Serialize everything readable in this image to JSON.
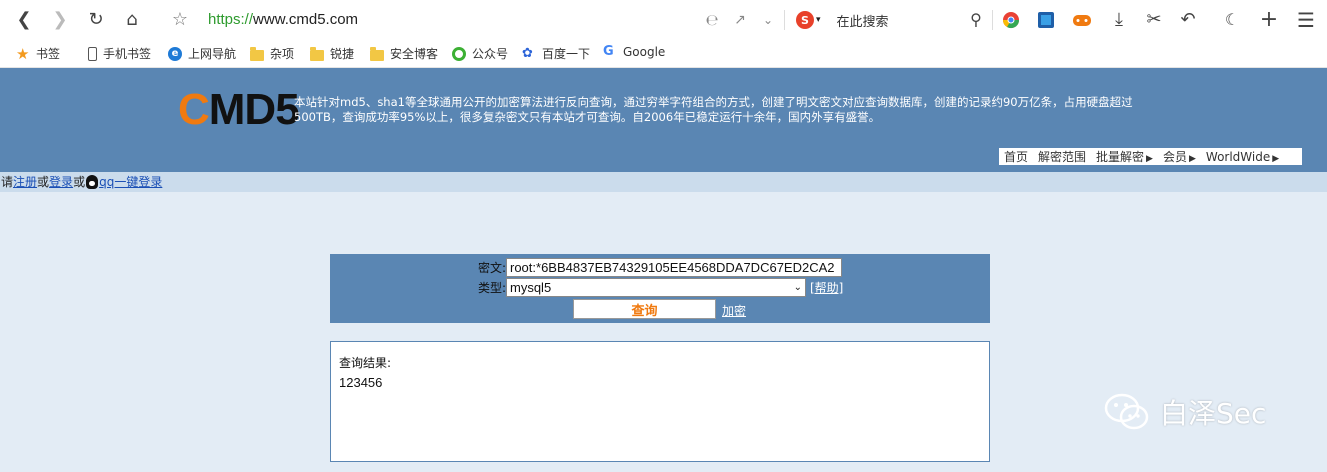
{
  "browser": {
    "url_scheme": "https://",
    "url_host": "www.cmd5.com",
    "search_placeholder": "在此搜索",
    "bookmarks": [
      "书签",
      "手机书签",
      "上网导航",
      "杂项",
      "锐捷",
      "安全博客",
      "公众号",
      "百度一下",
      "Google"
    ]
  },
  "site": {
    "logo_first": "C",
    "logo_rest": "MD5",
    "intro": "本站针对md5、sha1等全球通用公开的加密算法进行反向查询，通过穷举字符组合的方式，创建了明文密文对应查询数据库，创建的记录约90万亿条，占用硬盘超过500TB，查询成功率95%以上，很多复杂密文只有本站才可查询。自2006年已稳定运行十余年，国内外享有盛誉。",
    "nav": [
      "首页",
      "解密范围",
      "批量解密",
      "会员",
      "WorldWide"
    ]
  },
  "login": {
    "prefix": "请",
    "register": "注册",
    "or1": "或",
    "login": "登录",
    "or2": "或",
    "qq": "qq一键登录"
  },
  "form": {
    "cipher_label": "密文:",
    "cipher_value": "root:*6BB4837EB74329105EE4568DDA7DC67ED2CA2",
    "type_label": "类型:",
    "type_value": "mysql5",
    "help": "[帮助]",
    "query_button": "查询",
    "encrypt_link": "加密"
  },
  "result": {
    "label": "查询结果:",
    "value": "123456"
  },
  "watermark": "白泽Sec",
  "colors": {
    "header_bg": "#5a86b3",
    "page_bg": "#e3ecf5",
    "accent": "#f07a10"
  }
}
